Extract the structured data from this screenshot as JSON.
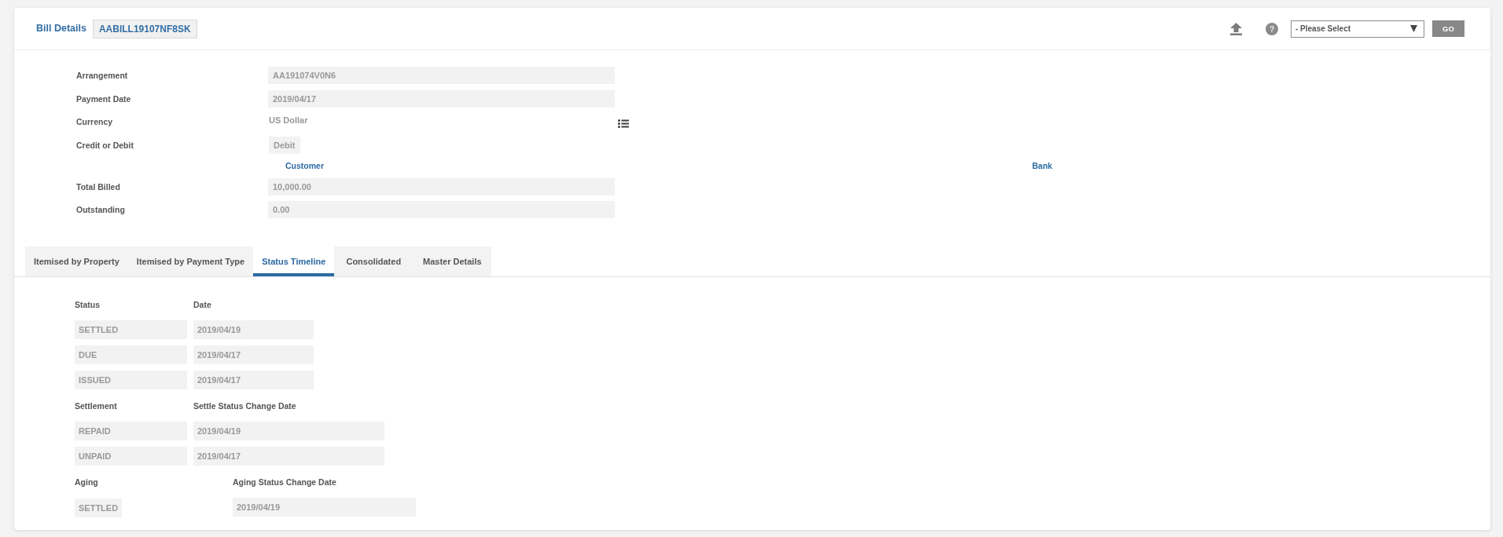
{
  "header": {
    "title": "Bill Details",
    "bill_id": "AABILL19107NF8SK",
    "help": "?",
    "select": {
      "value": "- Please Select"
    },
    "go_button": "GO"
  },
  "fields": [
    {
      "kind": "input",
      "label": "Arrangement",
      "value": "AA191074V0N6"
    },
    {
      "kind": "input",
      "label": "Payment Date",
      "value": "2019/04/17"
    },
    {
      "kind": "text",
      "label": "Currency",
      "value": "US Dollar"
    },
    {
      "kind": "chip",
      "label": "Credit or Debit",
      "value": "Debit"
    },
    {
      "kind": "links",
      "links": [
        "Customer",
        "Bank"
      ]
    },
    {
      "kind": "input",
      "label": "Total Billed",
      "value": "10,000.00"
    },
    {
      "kind": "input",
      "label": "Outstanding",
      "value": "0.00"
    }
  ],
  "tabs": [
    {
      "label": "Itemised by Property",
      "selected": false
    },
    {
      "label": "Itemised by Payment Type",
      "selected": false
    },
    {
      "label": "Status Timeline",
      "selected": true
    },
    {
      "label": "Consolidated",
      "selected": false
    },
    {
      "label": "Master Details",
      "selected": false
    }
  ],
  "timeline": [
    {
      "kind": "compact",
      "columns": [
        "Status",
        "Date"
      ],
      "rows": [
        [
          "SETTLED",
          "2019/04/19"
        ],
        [
          "DUE",
          "2019/04/17"
        ],
        [
          "ISSUED",
          "2019/04/17"
        ]
      ]
    },
    {
      "kind": "wide",
      "columns": [
        "Settlement",
        "Settle Status Change Date"
      ],
      "rows": [
        [
          "REPAID",
          "2019/04/19"
        ],
        [
          "UNPAID",
          "2019/04/17"
        ]
      ]
    },
    {
      "kind": "offset",
      "columns": [
        "Aging",
        "Aging Status Change Date"
      ],
      "rows": [
        [
          "SETTLED",
          "2019/04/19"
        ]
      ]
    }
  ]
}
